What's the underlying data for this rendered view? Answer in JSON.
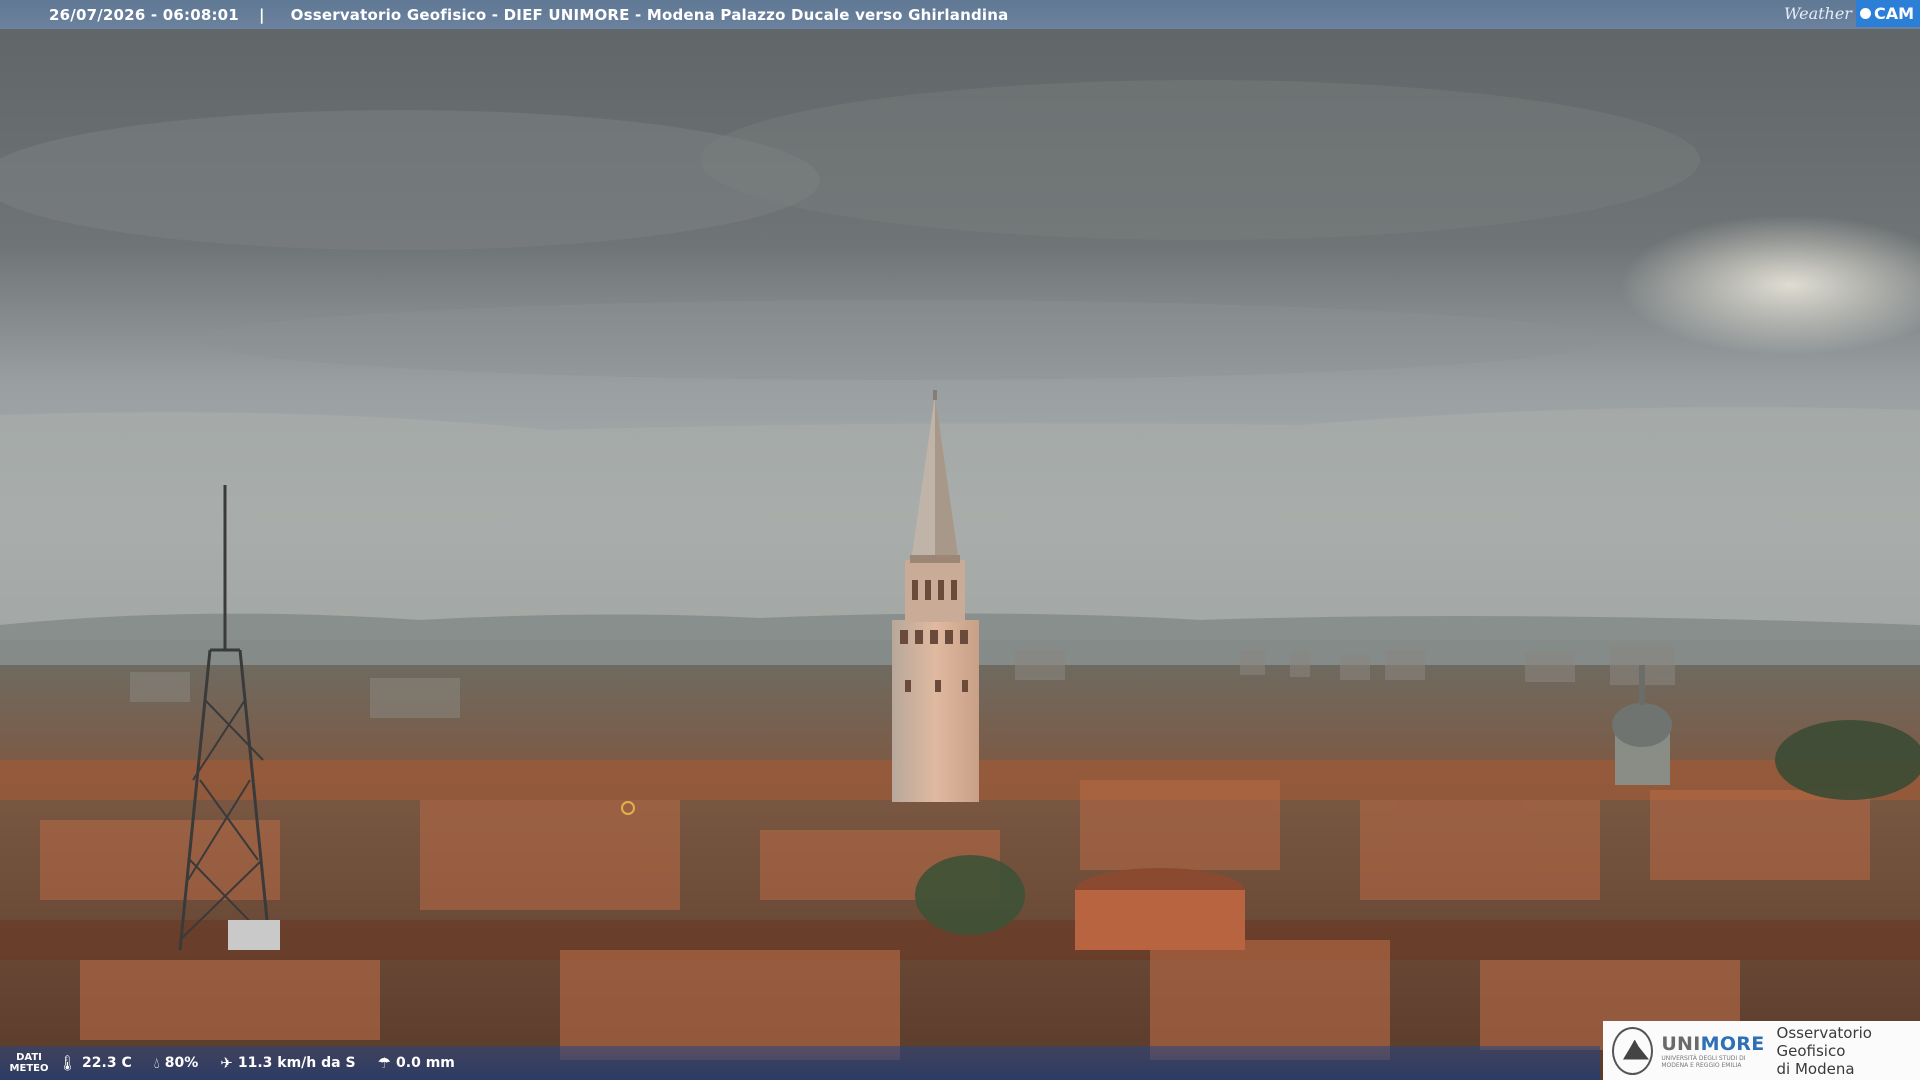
{
  "header": {
    "timestamp": "26/07/2026 - 06:08:01",
    "separator": "|",
    "title": "Osservatorio Geofisico - DIEF UNIMORE - Modena Palazzo Ducale verso Ghirlandina",
    "brand_weather": "Weather",
    "brand_cam": "CAM"
  },
  "meteo": {
    "label_line1": "DATI",
    "label_line2": "METEO",
    "temperature": "22.3 C",
    "humidity": "80%",
    "wind": "11.3 km/h da S",
    "rain": "0.0 mm",
    "icons": [
      "thermometer-icon",
      "humidity-drop-icon",
      "wind-icon",
      "rain-icon"
    ]
  },
  "logo": {
    "uni": "UNI",
    "more": "MORE",
    "subtitle_line1": "UNIVERSITÀ DEGLI STUDI DI",
    "subtitle_line2": "MODENA E REGGIO EMILIA",
    "observatory_line1": "Osservatorio Geofisico",
    "observatory_line2": "di Modena"
  },
  "colors": {
    "topbar": "#6a80a0",
    "brand_cam": "#2b7fd6",
    "unimore_blue": "#2e6fb5"
  }
}
